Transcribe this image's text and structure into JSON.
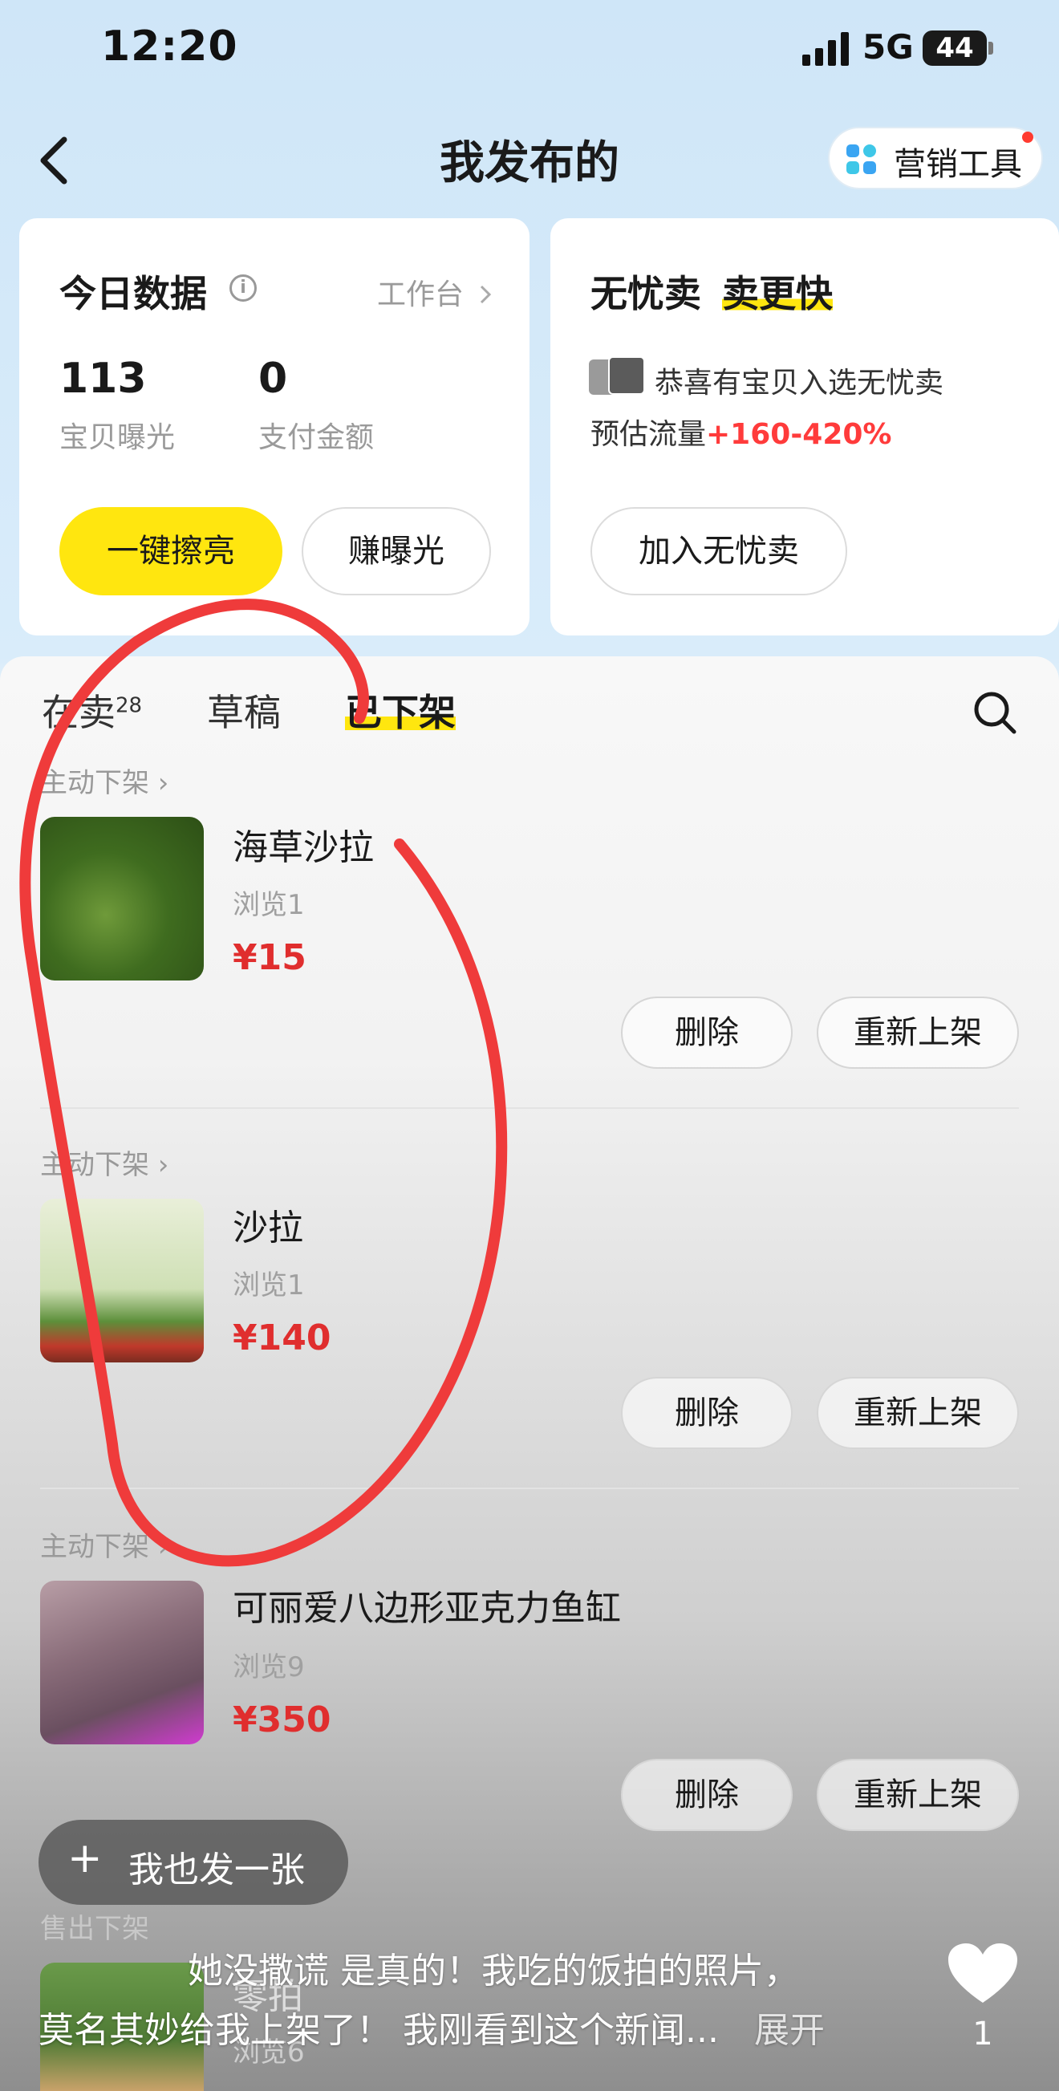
{
  "status_bar": {
    "time": "12:20",
    "network": "5G",
    "battery": "44"
  },
  "header": {
    "title": "我发布的",
    "marketing_label": "营销工具"
  },
  "today_card": {
    "title": "今日数据",
    "workbench_link": "工作台",
    "stats": [
      {
        "value": "113",
        "label": "宝贝曝光"
      },
      {
        "value": "0",
        "label": "支付金额"
      }
    ],
    "polish_button": "一键擦亮",
    "exposure_button": "赚曝光"
  },
  "worry_free_card": {
    "title_plain": "无忧卖",
    "title_highlight": "卖更快",
    "notice": "恭喜有宝贝入选无忧卖",
    "traffic_label": "预估流量",
    "traffic_value": "+160-420%",
    "join_button": "加入无忧卖"
  },
  "tabs": [
    {
      "label": "在卖",
      "badge": "28"
    },
    {
      "label": "草稿",
      "badge": ""
    },
    {
      "label": "已下架",
      "badge": ""
    }
  ],
  "items": [
    {
      "reason": "主动下架",
      "name": "海草沙拉",
      "views": "浏览1",
      "price": "¥15",
      "delete": "删除",
      "relist": "重新上架"
    },
    {
      "reason": "主动下架",
      "name": "沙拉",
      "views": "浏览1",
      "price": "¥140",
      "delete": "删除",
      "relist": "重新上架"
    },
    {
      "reason": "主动下架",
      "name": "可丽爱八边形亚克力鱼缸",
      "views": "浏览9",
      "price": "¥350",
      "delete": "删除",
      "relist": "重新上架"
    },
    {
      "reason": "售出下架",
      "name": "零拍",
      "views": "浏览6"
    }
  ],
  "fab_label": "我也发一张",
  "overlay": {
    "caption_line1": "她没撒谎 是真的！我吃的饭拍的照片，",
    "caption_line2": "莫名其妙给我上架了！ 我刚看到这个新闻...",
    "expand": "展开",
    "likes": "1"
  },
  "colors": {
    "accent_yellow": "#ffe60f",
    "price_red": "#e02e2e",
    "annotation_red": "#ef3b3b"
  }
}
